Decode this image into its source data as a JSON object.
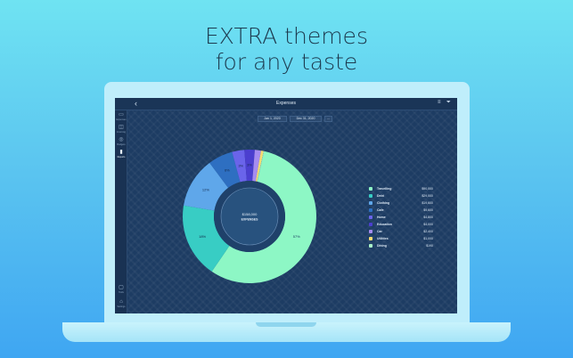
{
  "headline": {
    "line1": "EXTRA themes",
    "line2": "for any taste"
  },
  "app": {
    "title": "Expenses",
    "date_from": "Jan 1, 2020",
    "date_to": "Dec 31, 2020",
    "date_more": "...",
    "sidebar": [
      {
        "label": "Expenses",
        "icon": "wallet-icon"
      },
      {
        "label": "Incoming",
        "icon": "income-icon"
      },
      {
        "label": "Budgets",
        "icon": "budget-icon"
      },
      {
        "label": "Reports",
        "icon": "reports-icon"
      },
      {
        "label": "Tools",
        "icon": "tools-icon"
      },
      {
        "label": "Settings",
        "icon": "settings-icon"
      }
    ],
    "center_total": "$158,000",
    "center_label": "EXPENSES"
  },
  "chart_data": {
    "type": "pie",
    "categories": [
      "Travelling",
      "Debt",
      "Clothing",
      "Cafe",
      "Home",
      "Education",
      "Car",
      "Utilities",
      "Dining"
    ],
    "values": [
      90000,
      29000,
      19600,
      9600,
      4800,
      4000,
      2400,
      1000,
      190
    ],
    "amounts": [
      "$90,000",
      "$29,000",
      "$19,600",
      "$9,600",
      "$4,800",
      "$4,000",
      "$2,400",
      "$1,000",
      "$190"
    ],
    "percent_labels": [
      "57%",
      "18%",
      "12%",
      "6%",
      "3%",
      "3%",
      "",
      "",
      ""
    ],
    "colors": [
      "#8df7c5",
      "#38cdc4",
      "#5fa7ea",
      "#2e6fc1",
      "#6a64ea",
      "#4b3fcf",
      "#a58cf0",
      "#f7dc72",
      "#a9f5c9"
    ]
  }
}
